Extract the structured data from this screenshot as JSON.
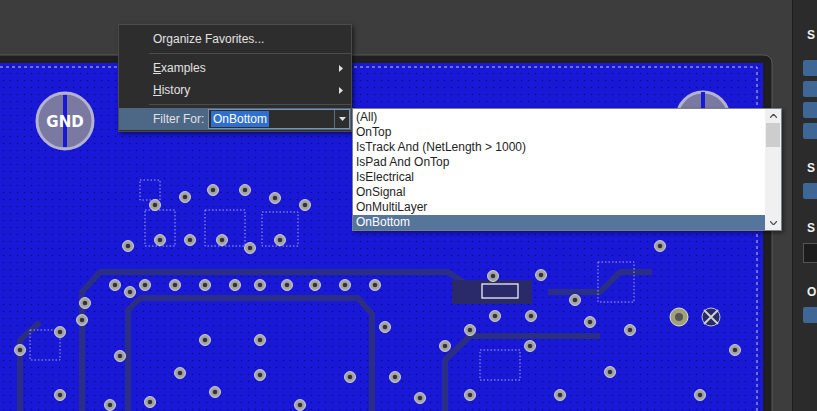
{
  "menu": {
    "items": [
      {
        "label": "Organize Favorites...",
        "kind": "action",
        "selected": false,
        "separator_after": true
      },
      {
        "label": "Examples",
        "kind": "submenu",
        "selected": false,
        "separator_after": false
      },
      {
        "label": "History",
        "kind": "submenu",
        "selected": false,
        "separator_after": true
      },
      {
        "label": "Filter For:",
        "kind": "filter",
        "selected": true,
        "separator_after": false
      }
    ]
  },
  "filter": {
    "value": "OnBottom",
    "value_selected": true,
    "open": true,
    "options": [
      {
        "label": "(All)",
        "selected": false
      },
      {
        "label": "OnTop",
        "selected": false
      },
      {
        "label": "IsTrack And (NetLength > 1000)",
        "selected": false
      },
      {
        "label": "IsPad And OnTop",
        "selected": false
      },
      {
        "label": "IsElectrical",
        "selected": false
      },
      {
        "label": "OnSignal",
        "selected": false
      },
      {
        "label": "OnMultiLayer",
        "selected": false
      },
      {
        "label": "OnBottom",
        "selected": true
      }
    ]
  },
  "board": {
    "logo_text": "GND"
  },
  "side_panel": {
    "labels": [
      "S",
      "S",
      "S",
      "O"
    ]
  }
}
